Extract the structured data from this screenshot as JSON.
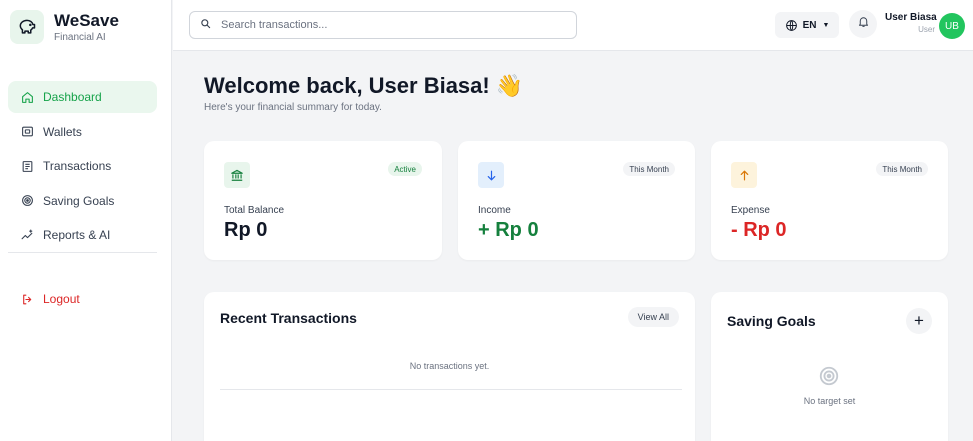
{
  "brand": {
    "name": "WeSave",
    "subtitle": "Financial AI"
  },
  "sidebar": {
    "items": [
      {
        "label": "Dashboard",
        "icon": "home-icon",
        "active": true
      },
      {
        "label": "Wallets",
        "icon": "wallet-icon"
      },
      {
        "label": "Transactions",
        "icon": "receipt-icon"
      },
      {
        "label": "Saving Goals",
        "icon": "target-icon"
      },
      {
        "label": "Reports & AI",
        "icon": "sparkle-chart-icon"
      }
    ],
    "logout_label": "Logout"
  },
  "topbar": {
    "search_placeholder": "Search transactions...",
    "language": "EN",
    "user_name": "User Biasa",
    "user_role": "User",
    "avatar_initials": "UB"
  },
  "welcome": {
    "title": "Welcome back, User Biasa! 👋",
    "subtitle": "Here's your financial summary for today."
  },
  "stats": {
    "balance": {
      "label": "Total Balance",
      "value": "Rp 0",
      "badge": "Active"
    },
    "income": {
      "label": "Income",
      "value": "+ Rp 0",
      "badge": "This Month"
    },
    "expense": {
      "label": "Expense",
      "value": "- Rp 0",
      "badge": "This Month"
    }
  },
  "recent": {
    "title": "Recent Transactions",
    "view_all": "View All",
    "empty": "No transactions yet."
  },
  "goals": {
    "title": "Saving Goals",
    "add": "+",
    "empty": "No target set"
  },
  "colors": {
    "accent": "#16a34a",
    "income": "#15803d",
    "expense": "#dc2626",
    "avatar": "#22c55e",
    "active_nav_bg": "#eaf7ee"
  }
}
